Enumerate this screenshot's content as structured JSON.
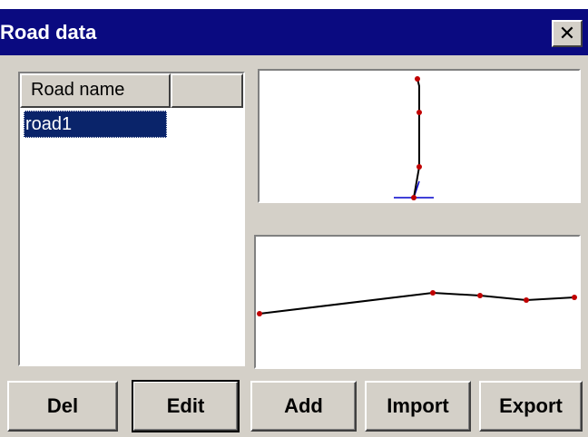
{
  "window": {
    "title": "Road data",
    "close_glyph": "✕",
    "title_bar_color": "#0a0a80",
    "face_color": "#d4d0c8"
  },
  "road_list": {
    "columns": [
      "Road name",
      ""
    ],
    "rows": [
      {
        "name": "road1",
        "selected": true
      }
    ],
    "selection_color": "#0a246a"
  },
  "plan_view": {
    "polyline_color": "#000000",
    "marker_color": "#c00000",
    "axis_color": "#0000cc"
  },
  "profile_view": {
    "polyline_color": "#000000",
    "marker_color": "#c00000"
  },
  "buttons": {
    "del": "Del",
    "edit": "Edit",
    "add": "Add",
    "import": "Import",
    "export": "Export"
  }
}
